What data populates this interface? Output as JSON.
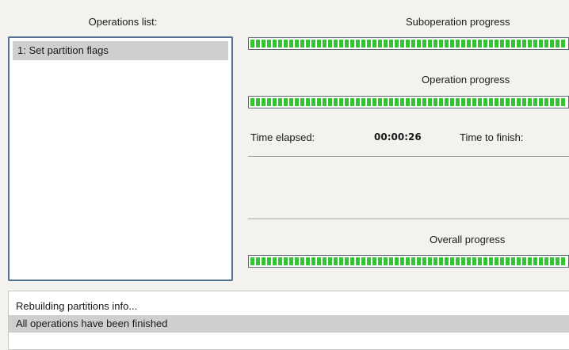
{
  "operations_panel": {
    "title": "Operations list:",
    "items": [
      {
        "label": "1: Set partition flags"
      }
    ]
  },
  "progress": {
    "suboperation_label": "Suboperation progress",
    "suboperation_value": 1.0,
    "operation_label": "Operation progress",
    "operation_value": 1.0,
    "overall_label": "Overall progress",
    "overall_value": 1.0,
    "bar_color": "#33c333"
  },
  "time": {
    "elapsed_label": "Time elapsed:",
    "elapsed_value": "00:00:26",
    "finish_label": "Time to finish:"
  },
  "log": {
    "lines": [
      {
        "text": "Rebuilding partitions info..."
      },
      {
        "text": "All operations have been finished"
      }
    ]
  }
}
